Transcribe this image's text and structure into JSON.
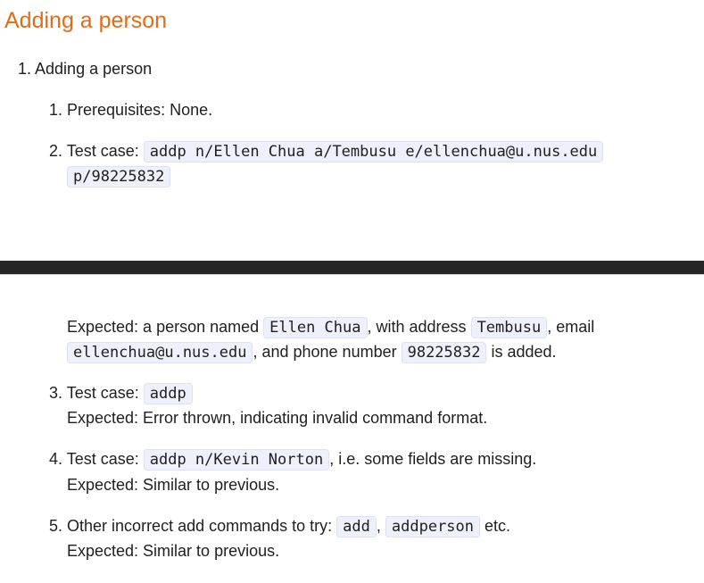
{
  "heading": "Adding a person",
  "item1": {
    "num": "1.",
    "label": "Adding a person"
  },
  "sub1": {
    "num": "1.",
    "text": "Prerequisites: None."
  },
  "sub2": {
    "num": "2.",
    "prefix": "Test case: ",
    "code_a": "addp n/Ellen Chua a/Tembusu e/ellenchua@u.nus.edu",
    "code_b": "p/98225832",
    "exp1": "Expected: a person named ",
    "name": "Ellen Chua",
    "exp2": ", with address ",
    "address": "Tembusu",
    "exp3": ", email",
    "email": "ellenchua@u.nus.edu",
    "exp4": ", and phone number ",
    "phone": "98225832",
    "exp5": " is added."
  },
  "sub3": {
    "num": "3.",
    "prefix": "Test case: ",
    "code": "addp",
    "expected": "Expected: Error thrown, indicating invalid command format."
  },
  "sub4": {
    "num": "4.",
    "prefix": "Test case: ",
    "code": "addp n/Kevin Norton",
    "suffix": ", i.e. some fields are missing.",
    "expected": "Expected: Similar to previous."
  },
  "sub5": {
    "num": "5.",
    "prefix": "Other incorrect add commands to try: ",
    "code_a": "add",
    "sep": ", ",
    "code_b": "addperson",
    "suffix": " etc.",
    "expected": "Expected: Similar to previous."
  }
}
